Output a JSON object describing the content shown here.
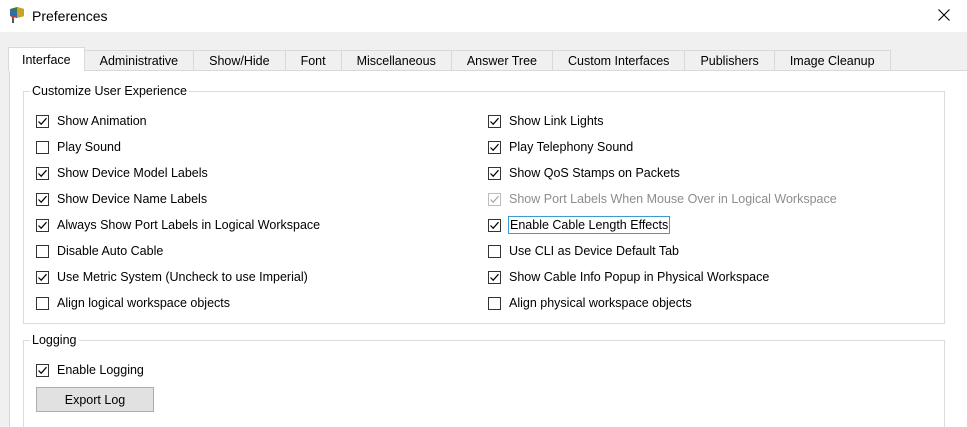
{
  "window": {
    "title": "Preferences",
    "icon": "packet-tracer-icon",
    "close_icon": "close-icon"
  },
  "tabs": [
    {
      "label": "Interface",
      "active": true
    },
    {
      "label": "Administrative",
      "active": false
    },
    {
      "label": "Show/Hide",
      "active": false
    },
    {
      "label": "Font",
      "active": false
    },
    {
      "label": "Miscellaneous",
      "active": false
    },
    {
      "label": "Answer Tree",
      "active": false
    },
    {
      "label": "Custom Interfaces",
      "active": false
    },
    {
      "label": "Publishers",
      "active": false
    },
    {
      "label": "Image Cleanup",
      "active": false
    }
  ],
  "customize": {
    "title": "Customize User Experience",
    "left": [
      {
        "label": "Show Animation",
        "checked": true
      },
      {
        "label": "Play Sound",
        "checked": false
      },
      {
        "label": "Show Device Model Labels",
        "checked": true
      },
      {
        "label": "Show Device Name Labels",
        "checked": true
      },
      {
        "label": "Always Show Port Labels in Logical Workspace",
        "checked": true
      },
      {
        "label": "Disable Auto Cable",
        "checked": false
      },
      {
        "label": "Use Metric System (Uncheck to use Imperial)",
        "checked": true
      },
      {
        "label": "Align logical workspace objects",
        "checked": false
      }
    ],
    "right": [
      {
        "label": "Show Link Lights",
        "checked": true
      },
      {
        "label": "Play Telephony Sound",
        "checked": true
      },
      {
        "label": "Show QoS Stamps on Packets",
        "checked": true
      },
      {
        "label": "Show Port Labels When Mouse Over in Logical Workspace",
        "checked": true,
        "disabled": true
      },
      {
        "label": "Enable Cable Length Effects",
        "checked": true,
        "focused": true
      },
      {
        "label": "Use CLI as Device Default Tab",
        "checked": false
      },
      {
        "label": "Show Cable Info Popup in Physical Workspace",
        "checked": true
      },
      {
        "label": "Align physical workspace objects",
        "checked": false
      }
    ]
  },
  "logging": {
    "title": "Logging",
    "enable_label": "Enable Logging",
    "enable_checked": true,
    "export_button": "Export Log"
  },
  "colors": {
    "focus_outline": "#3a9bd5",
    "disabled_text": "#8d8d8d"
  }
}
